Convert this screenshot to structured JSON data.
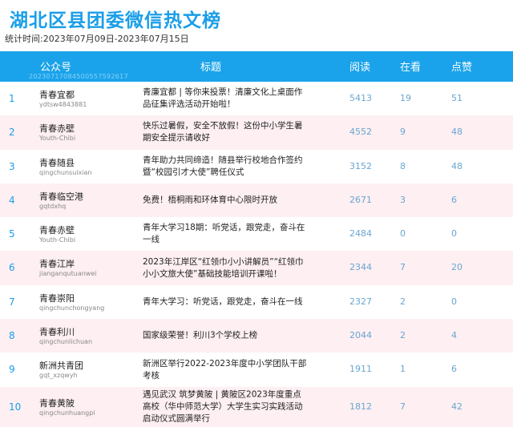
{
  "page": {
    "title": "湖北区县团委微信热文榜",
    "period": "统计时间:2023年07月09日-2023年07月15日"
  },
  "table": {
    "headers": {
      "account": "公众号",
      "title": "标题",
      "read": "阅读",
      "view": "在看",
      "like": "点赞"
    },
    "stamp": "20230717084500557592617",
    "rows": [
      {
        "rank": "1",
        "account": "青春宜都",
        "account_id": "ydtsw4843881",
        "title": "青廉宜都 | 等你来投票！清廉文化上桌面作品征集评选活动开始啦！",
        "read": "5413",
        "view": "19",
        "like": "51"
      },
      {
        "rank": "2",
        "account": "青春赤壁",
        "account_id": "Youth-Chibi",
        "title": "快乐过暑假，安全不放假！这份中小学生暑期安全提示请收好",
        "read": "4552",
        "view": "9",
        "like": "48"
      },
      {
        "rank": "3",
        "account": "青春随县",
        "account_id": "qingchunsuixian",
        "title": "青年助力共同缔造！随县举行校地合作签约暨“校园引才大使”聘任仪式",
        "read": "3152",
        "view": "8",
        "like": "48"
      },
      {
        "rank": "4",
        "account": "青春临空港",
        "account_id": "gqtdxhq",
        "title": "免费！梧桐雨和环体育中心限时开放",
        "read": "2671",
        "view": "3",
        "like": "6"
      },
      {
        "rank": "5",
        "account": "青春赤壁",
        "account_id": "Youth-Chibi",
        "title": "青年大学习18期：听党话，跟党走，奋斗在一线",
        "read": "2484",
        "view": "0",
        "like": "0"
      },
      {
        "rank": "6",
        "account": "青春江岸",
        "account_id": "jianganqutuanwei",
        "title": "2023年江岸区“红领巾小小讲解员”“红领巾小小文旅大使”基础技能培训开课啦！",
        "read": "2344",
        "view": "7",
        "like": "20"
      },
      {
        "rank": "7",
        "account": "青春崇阳",
        "account_id": "qingchunchongyang",
        "title": "青年大学习：听党话，跟党走，奋斗在一线",
        "read": "2327",
        "view": "2",
        "like": "0"
      },
      {
        "rank": "8",
        "account": "青春利川",
        "account_id": "qingchunlichuan",
        "title": "国家级荣誉！利川3个学校上榜",
        "read": "2044",
        "view": "2",
        "like": "4"
      },
      {
        "rank": "9",
        "account": "新洲共青团",
        "account_id": "gqt_xzqwyh",
        "title": "新洲区举行2022-2023年度中小学团队干部考核",
        "read": "1911",
        "view": "1",
        "like": "6"
      },
      {
        "rank": "10",
        "account": "青春黄陂",
        "account_id": "qingchunhuangpi",
        "title": "遇见武汉 筑梦黄陂 | 黄陂区2023年度重点高校（华中师范大学）大学生实习实践活动启动仪式圆满举行",
        "read": "1812",
        "view": "7",
        "like": "42"
      }
    ]
  },
  "colors": {
    "accent": "#1a9ee8",
    "header_bg": "#1aa3ea",
    "alt_row_bg": "#fdeff2",
    "number_text": "#6aa6d0"
  }
}
